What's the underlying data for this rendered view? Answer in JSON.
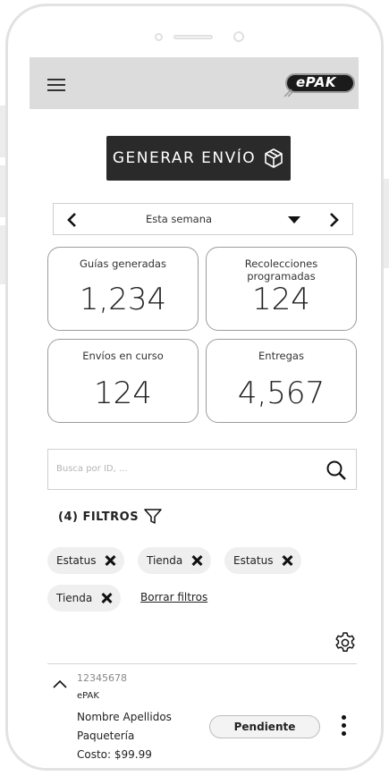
{
  "header": {
    "menu_icon": "hamburger-icon",
    "logo_text": "ePAK"
  },
  "actions": {
    "generate_label": "GENERAR ENVÍO",
    "generate_icon": "box-icon"
  },
  "period": {
    "label": "Esta semana",
    "prev_icon": "chevron-left-icon",
    "next_icon": "chevron-right-icon",
    "dropdown_icon": "caret-down-icon"
  },
  "stats": {
    "guides": {
      "label": "Guías generadas",
      "value": "1,234"
    },
    "pickups": {
      "label": "Recolecciones programadas",
      "value": "124"
    },
    "in_transit": {
      "label": "Envíos en curso",
      "value": "124"
    },
    "deliveries": {
      "label": "Entregas",
      "value": "4,567"
    }
  },
  "search": {
    "placeholder": "Busca por ID, ...",
    "icon": "search-icon"
  },
  "filters": {
    "label": "(4) FILTROS",
    "icon": "filter-icon",
    "chips": [
      "Estatus",
      "Tienda",
      "Estatus",
      "Tienda"
    ],
    "clear_label": "Borrar filtros"
  },
  "settings_icon": "gear-icon",
  "shipment": {
    "id": "12345678",
    "store": "ePAK",
    "name": "Nombre Apellidos",
    "carrier": "Paquetería",
    "cost": "Costo: $99.99",
    "status": "Pendiente",
    "more_icon": "kebab-icon",
    "collapse_icon": "chevron-up-icon"
  }
}
